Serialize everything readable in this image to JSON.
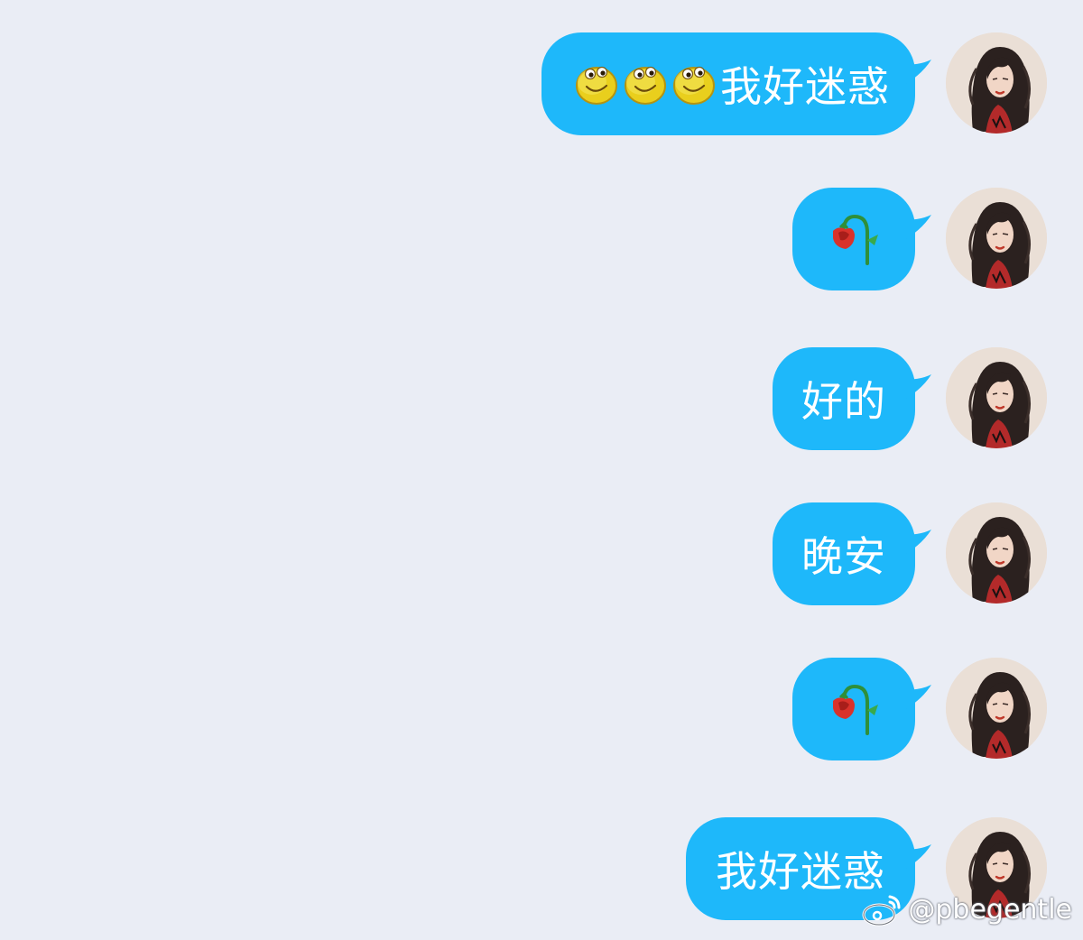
{
  "messages": [
    {
      "type": "text",
      "emoji_prefix": [
        "smiley-face",
        "smiley-face",
        "smiley-face"
      ],
      "text": "我好迷惑"
    },
    {
      "type": "emoji",
      "emoji": "wilted-rose",
      "text": ""
    },
    {
      "type": "text",
      "text": "好的"
    },
    {
      "type": "text",
      "text": "晚安"
    },
    {
      "type": "emoji",
      "emoji": "wilted-rose",
      "text": ""
    },
    {
      "type": "text",
      "text": "我好迷惑"
    }
  ],
  "watermark": {
    "text": "@pbegentle",
    "icon": "weibo-icon"
  },
  "colors": {
    "background": "#eaedf5",
    "bubble": "#1eb8fa",
    "bubble_text": "#ffffff"
  }
}
